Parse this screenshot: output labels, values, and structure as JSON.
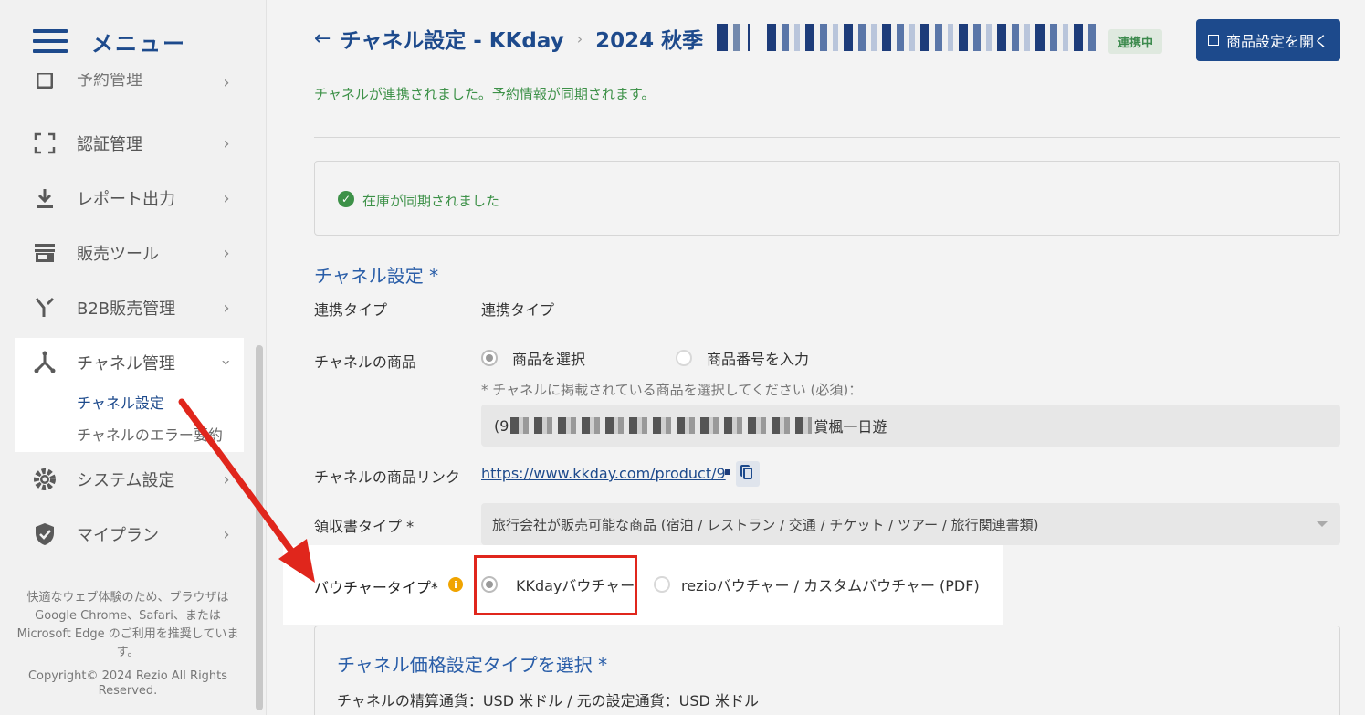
{
  "sidebar": {
    "menu_title": "メニュー",
    "items": [
      {
        "label": "予約管理",
        "icon": "calendar-icon"
      },
      {
        "label": "認証管理",
        "icon": "scan-icon"
      },
      {
        "label": "レポート出力",
        "icon": "download-icon"
      },
      {
        "label": "販売ツール",
        "icon": "store-icon"
      },
      {
        "label": "B2B販売管理",
        "icon": "merge-icon"
      },
      {
        "label": "チャネル管理",
        "icon": "channel-icon"
      },
      {
        "label": "システム設定",
        "icon": "gear-icon"
      },
      {
        "label": "マイプラン",
        "icon": "shield-icon"
      }
    ],
    "sub_items": [
      {
        "label": "チャネル設定",
        "active": true
      },
      {
        "label": "チャネルのエラー要約",
        "active": false
      }
    ],
    "browser_note": "快適なウェブ体験のため、ブラウザは Google Chrome、Safari、または Microsoft Edge のご利用を推奨しています。",
    "copyright": "Copyright© 2024 Rezio All Rights Reserved."
  },
  "header": {
    "title": "チャネル設定 - KKday",
    "product_prefix": "2024 秋季",
    "status_badge": "連携中",
    "open_button": "商品設定を開く"
  },
  "main": {
    "success_message": "チャネルが連携されました。予約情報が同期されます。",
    "sync_message": "在庫が同期されました",
    "section_title": "チャネル設定 *",
    "link_type_label": "連携タイプ",
    "link_type_value": "連携タイプ",
    "channel_product_label": "チャネルの商品",
    "product_options": [
      "商品を選択",
      "商品番号を入力"
    ],
    "product_hint": "* チャネルに掲載されている商品を選択してください (必須)：",
    "product_select_prefix": "(9",
    "product_select_suffix": "賞楓一日遊",
    "product_link_label": "チャネルの商品リンク",
    "product_link": "https://www.kkday.com/product/9",
    "receipt_label": "領収書タイプ *",
    "receipt_value": "旅行会社が販売可能な商品 (宿泊 / レストラン / 交通 / チケット / ツアー / 旅行関連書類)",
    "voucher_label": "バウチャータイプ*",
    "voucher_info": "i",
    "voucher_options": [
      "KKdayバウチャー",
      "rezioバウチャー / カスタムバウチャー (PDF)"
    ],
    "price_section_title": "チャネル価格設定タイプを選択 *",
    "price_currency_note": "チャネルの精算通貨：USD 米ドル / 元の設定通貨：USD 米ドル"
  },
  "colors": {
    "brand": "#1d4a8c",
    "accent_red": "#e0261c",
    "success": "#3d9148"
  }
}
